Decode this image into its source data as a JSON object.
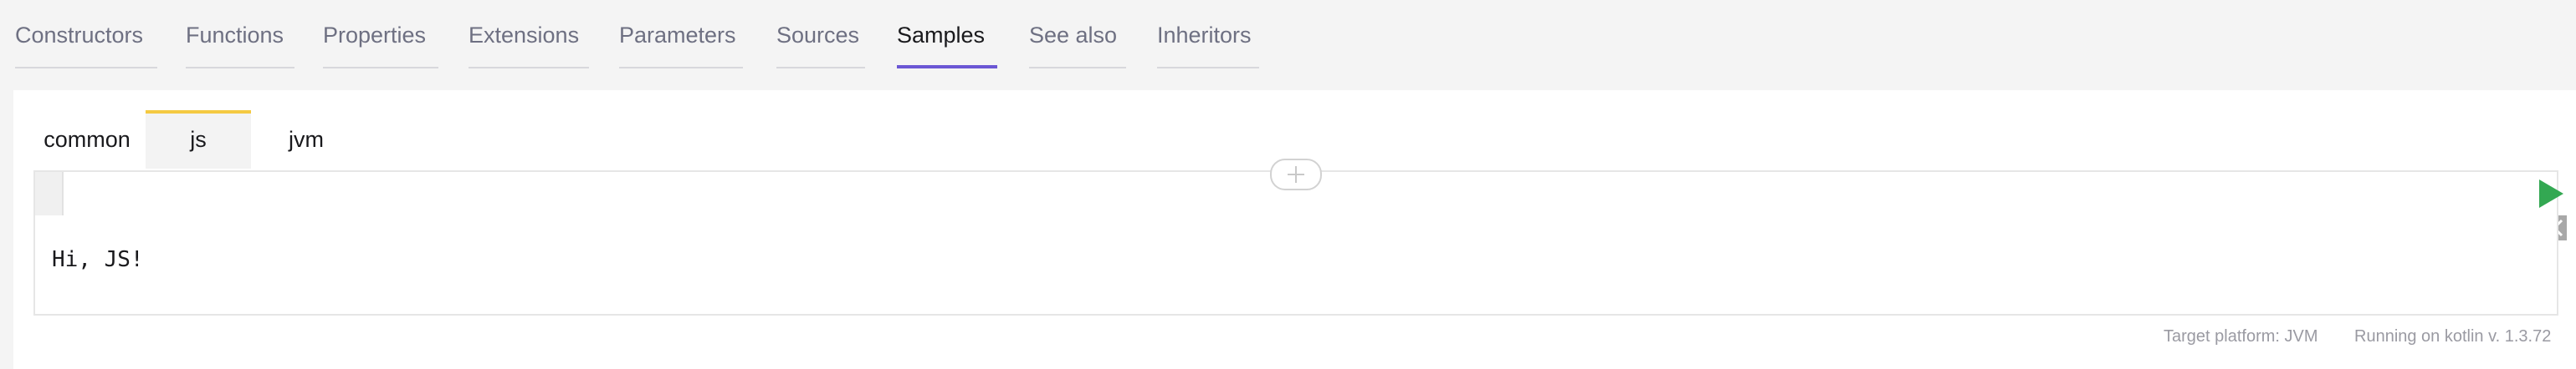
{
  "section_tabs": [
    {
      "label": "Constructors"
    },
    {
      "label": "Functions"
    },
    {
      "label": "Properties"
    },
    {
      "label": "Extensions"
    },
    {
      "label": "Parameters"
    },
    {
      "label": "Sources"
    },
    {
      "label": "Samples",
      "active": true
    },
    {
      "label": "See also"
    },
    {
      "label": "Inheritors"
    }
  ],
  "platform_tabs": [
    {
      "label": "common"
    },
    {
      "label": "js",
      "active": true
    },
    {
      "label": "jvm"
    }
  ],
  "editor": {
    "code": "",
    "expand_icon": "plus-icon",
    "run_icon": "play-icon",
    "close_icon": "close-icon"
  },
  "output": {
    "text": "Hi, JS!"
  },
  "footer": {
    "target_platform": "Target platform: JVM",
    "running_on": "Running on kotlin v. 1.3.72"
  },
  "colors": {
    "active_tab_underline": "#6b57d4",
    "platform_active_bar": "#f4c942",
    "run_button": "#33a852"
  }
}
